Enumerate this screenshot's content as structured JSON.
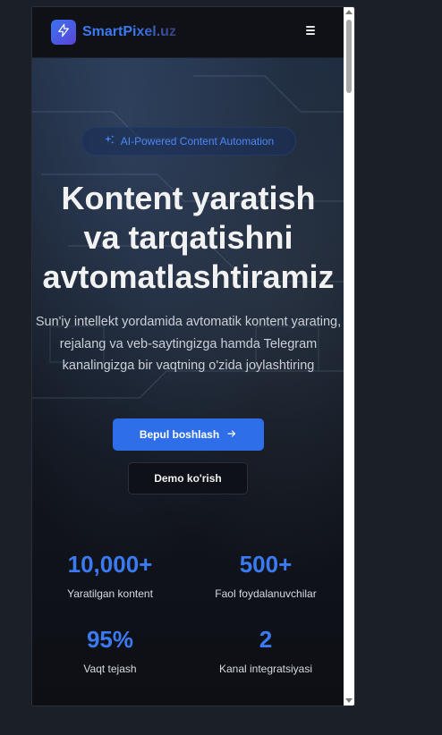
{
  "header": {
    "brand_main": "SmartPixel",
    "brand_suffix": ".uz",
    "logo_icon": "lightning-bolt-icon",
    "menu_icon": "hamburger-menu-icon"
  },
  "hero": {
    "badge_icon": "sparkles-icon",
    "badge_text": "AI-Powered Content Automation",
    "title_line1": "Kontent yaratish",
    "title_line2": "va tarqatishni",
    "title_line3": "avtomatlashtiramiz",
    "subtitle": "Sun'iy intellekt yordamida avtomatik kontent yarating, rejalang va veb-saytingizga hamda Telegram kanalingizga bir vaqtning o'zida joylashtiring",
    "primary_button": "Bepul boshlash",
    "primary_button_icon": "arrow-right-icon",
    "secondary_button": "Demo ko'rish"
  },
  "stats": [
    {
      "value": "10,000+",
      "label": "Yaratilgan kontent"
    },
    {
      "value": "500+",
      "label": "Faol foydalanuvchilar"
    },
    {
      "value": "95%",
      "label": "Vaqt tejash"
    },
    {
      "value": "2",
      "label": "Kanal integratsiyasi"
    }
  ],
  "colors": {
    "accent": "#2f6ee9",
    "stat_value": "#3a7af2",
    "background": "#0d0f15"
  }
}
